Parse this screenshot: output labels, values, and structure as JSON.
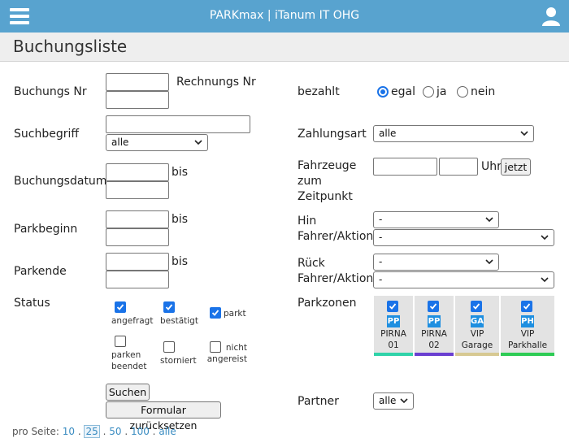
{
  "header": {
    "title": "PARKmax | iTanum IT OHG",
    "menu_icon": "hamburger-menu-icon",
    "user_icon": "user-account-icon"
  },
  "page": {
    "title": "Buchungsliste"
  },
  "form": {
    "buchungs_nr_label": "Buchungs Nr",
    "rechnungs_nr_label": "Rechnungs Nr",
    "suchbegriff_label": "Suchbegriff",
    "suchbegriff_select": "alle",
    "buchungsdatum_label": "Buchungsdatum",
    "parkbeginn_label": "Parkbeginn",
    "parkende_label": "Parkende",
    "bis": "bis",
    "status_label": "Status",
    "status": [
      {
        "label": "angefragt",
        "checked": true
      },
      {
        "label": "bestätigt",
        "checked": true
      },
      {
        "label": "parkt",
        "checked": true
      },
      {
        "label": "parken beendet",
        "checked": false
      },
      {
        "label": "storniert",
        "checked": false
      },
      {
        "label": "nicht angereist",
        "checked": false
      }
    ],
    "suchen_button": "Suchen",
    "reset_button": "Formular zurücksetzen",
    "bezahlt_label": "bezahlt",
    "bezahlt_options": [
      {
        "label": "egal",
        "selected": true
      },
      {
        "label": "ja",
        "selected": false
      },
      {
        "label": "nein",
        "selected": false
      }
    ],
    "zahlungsart_label": "Zahlungsart",
    "zahlungsart_select": "alle",
    "fahrzeuge_label_1": "Fahrzeuge",
    "fahrzeuge_label_2": "zum",
    "fahrzeuge_label_3": "Zeitpunkt",
    "uhr": "Uhr",
    "jetzt_button": "jetzt",
    "hin_label_1": "Hin",
    "hin_label_2": "Fahrer/Aktion",
    "hin_select_1": "-",
    "hin_select_2": "-",
    "rueck_label_1": "Rück",
    "rueck_label_2": "Fahrer/Aktion",
    "rueck_select_1": "-",
    "rueck_select_2": "-",
    "parkzonen_label": "Parkzonen",
    "zones": [
      {
        "badge": "PP",
        "line1": "PIRNA",
        "line2": "01",
        "color": "#2fd3a9",
        "checked": true
      },
      {
        "badge": "PP",
        "line1": "PIRNA",
        "line2": "02",
        "color": "#6a3fd1",
        "checked": true
      },
      {
        "badge": "GA",
        "line1": "VIP",
        "line2": "Garage",
        "color": "#d7c992",
        "checked": true
      },
      {
        "badge": "PH",
        "line1": "VIP",
        "line2": "Parkhalle",
        "color": "#2ecc55",
        "checked": true
      }
    ],
    "partner_label": "Partner",
    "partner_select": "alle"
  },
  "pager": {
    "label": "pro Seite:",
    "options": [
      "10",
      "25",
      "50",
      "100",
      "alle"
    ],
    "current": "25"
  },
  "colors": {
    "header_bg": "#58a3cf",
    "accent": "#1a73e8",
    "badge": "#1e8fe0"
  }
}
